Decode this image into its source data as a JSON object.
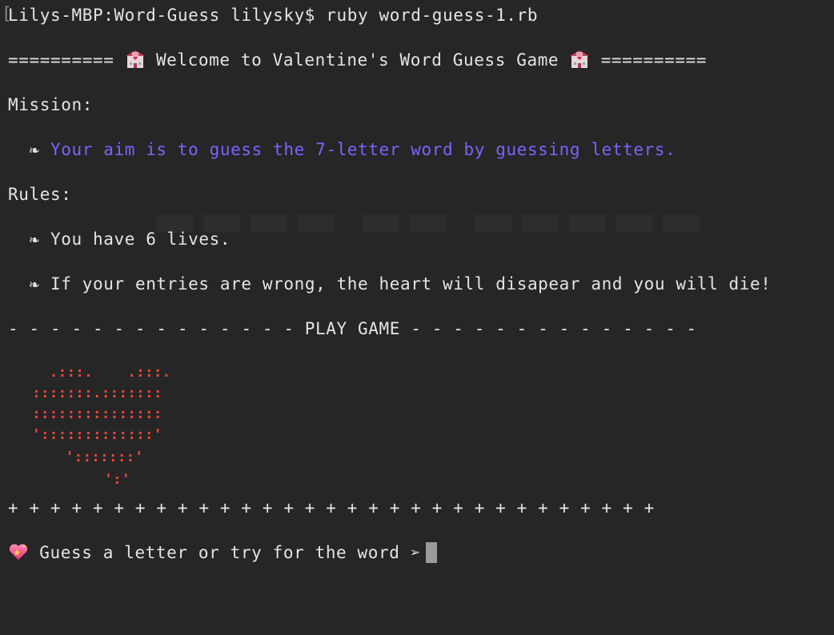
{
  "prompt_line": "Lilys-MBP:Word-Guess lilysky$ ruby word-guess-1.rb",
  "welcome": {
    "left_rule": "==========",
    "title": "Welcome to Valentine's Word Guess Game",
    "right_rule": "==========",
    "icon": "love-hotel-icon"
  },
  "mission": {
    "heading": "Mission:",
    "bullet": "❧",
    "text": "Your aim is to guess the 7-letter word by guessing letters.",
    "text_color": "#7a63ff"
  },
  "rules": {
    "heading": "Rules:",
    "items": [
      "You have 6 lives.",
      "If your entries are wrong, the heart will disapear and you will die!"
    ]
  },
  "play_game_divider": "- - - - - - - - - - - - - - PLAY GAME - - - - - - - - - - - - - -",
  "heart_art": {
    "color": "#e8453c",
    "lines": [
      "  .:::.    .:::.",
      ":::::::.:::::::",
      ":::::::::::::::",
      "':::::::::::::'",
      "  ':::::::'",
      "     ':'"
    ]
  },
  "plus_divider": "+ + + + + + + + + + + + + + + + + + + + + + + + + + + + + + +",
  "input_prompt": {
    "icon": "sparkling-heart-icon",
    "text": "Guess a letter or try for the word ➢"
  }
}
